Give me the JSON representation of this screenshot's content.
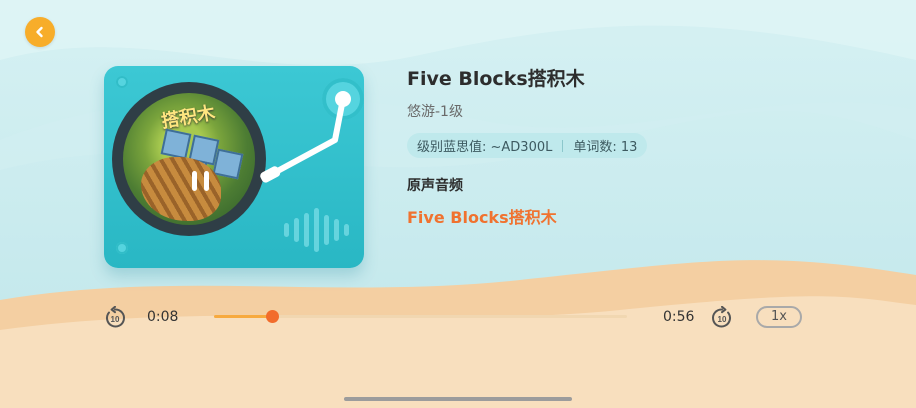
{
  "colors": {
    "sky_top": "#c7ebef",
    "sand": "#f7dfbf",
    "back_button": "#f7ad2a",
    "player_card": "#33c0cc",
    "accent_orange": "#f0722f",
    "progress_fill": "#f7aa3f"
  },
  "icons": {
    "back": "chevron-left-icon",
    "rewind": "rewind-10-icon",
    "forward": "forward-10-icon",
    "pause": "pause-icon"
  },
  "book": {
    "title": "Five Blocks搭积木",
    "series": "悠游-1级",
    "level_tag": "级别蓝思值: ~AD300L",
    "word_count_tag": "单词数: 13",
    "cover_text": "搭积木"
  },
  "audio": {
    "heading": "原声音频",
    "track": "Five  Blocks搭积木"
  },
  "player": {
    "current_time": "0:08",
    "total_time": "0:56",
    "progress_fraction": 0.14,
    "speed": "1x",
    "rewind_seconds": "10",
    "forward_seconds": "10"
  }
}
